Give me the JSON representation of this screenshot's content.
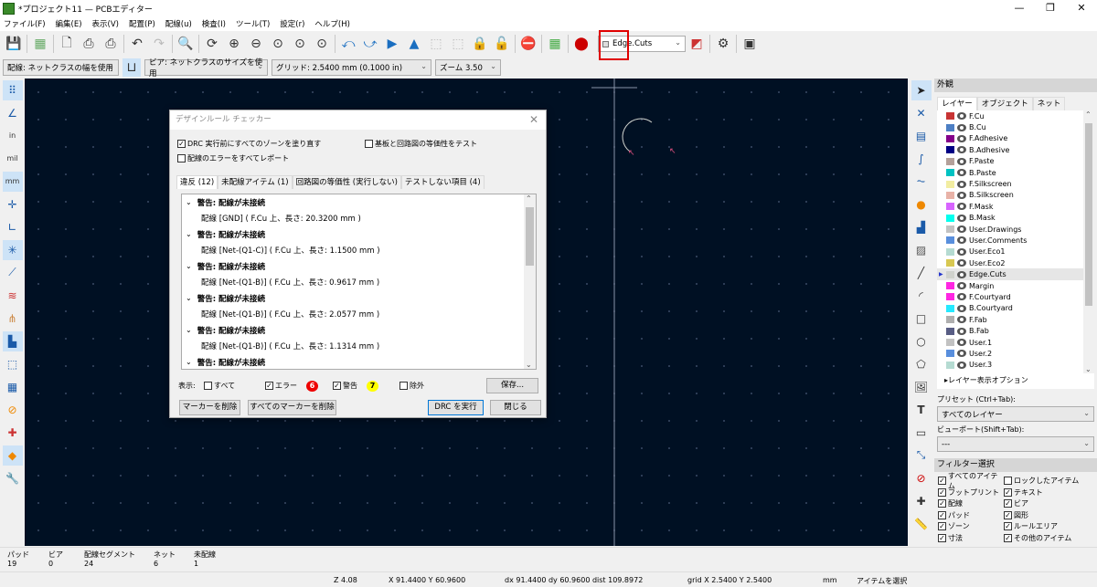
{
  "window": {
    "title": "*プロジェクト11 — PCBエディター"
  },
  "menu": [
    "ファイル(F)",
    "編集(E)",
    "表示(V)",
    "配置(P)",
    "配線(u)",
    "検査(I)",
    "ツール(T)",
    "設定(r)",
    "ヘルプ(H)"
  ],
  "toolbar": {
    "layer_select": "Edge.Cuts"
  },
  "toolbar2": {
    "track": "配線: ネットクラスの幅を使用",
    "via": "ビア: ネットクラスのサイズを使用",
    "grid": "グリッド: 2.5400 mm (0.1000 in)",
    "zoom": "ズーム 3.50"
  },
  "drc": {
    "title": "デザインルール チェッカー",
    "opt_refill": "DRC 実行前にすべてのゾーンを塗り直す",
    "opt_report_all": "配線のエラーをすべてレポート",
    "opt_parity": "基板と回路図の等価性をテスト",
    "tabs": [
      "違反 (12)",
      "未配線アイテム (1)",
      "回路図の等価性 (実行しない)",
      "テストしない項目 (4)"
    ],
    "items": [
      {
        "h": "警告: 配線が未接続",
        "d": "配線 [GND] ( F.Cu 上、長さ: 20.3200 mm )"
      },
      {
        "h": "警告: 配線が未接続",
        "d": "配線 [Net-(Q1-C)] ( F.Cu 上、長さ: 1.1500 mm )"
      },
      {
        "h": "警告: 配線が未接続",
        "d": "配線 [Net-(Q1-B)] ( F.Cu 上、長さ: 0.9617 mm )"
      },
      {
        "h": "警告: 配線が未接続",
        "d": "配線 [Net-(Q1-B)] ( F.Cu 上、長さ: 2.0577 mm )"
      },
      {
        "h": "警告: 配線が未接続",
        "d": "配線 [Net-(Q1-B)] ( F.Cu 上、長さ: 1.1314 mm )"
      },
      {
        "h": "警告: 配線が未接続"
      }
    ],
    "show_label": "表示:",
    "show_all": "すべて",
    "show_errors": "エラー",
    "error_count": "6",
    "show_warnings": "警告",
    "warning_count": "7",
    "show_excluded": "除外",
    "save": "保存...",
    "delete_markers": "マーカーを削除",
    "delete_all_markers": "すべてのマーカーを削除",
    "run": "DRC を実行",
    "close": "閉じる"
  },
  "panel": {
    "title": "外観",
    "tabs": [
      "レイヤー",
      "オブジェクト",
      "ネット"
    ],
    "layers": [
      {
        "n": "F.Cu",
        "c": "#c83434"
      },
      {
        "n": "B.Cu",
        "c": "#4d7fc4"
      },
      {
        "n": "F.Adhesive",
        "c": "#84008a"
      },
      {
        "n": "B.Adhesive",
        "c": "#000084"
      },
      {
        "n": "F.Paste",
        "c": "#b4a09a"
      },
      {
        "n": "B.Paste",
        "c": "#00c2c2"
      },
      {
        "n": "F.Silkscreen",
        "c": "#f2eda1"
      },
      {
        "n": "B.Silkscreen",
        "c": "#e8b2a7"
      },
      {
        "n": "F.Mask",
        "c": "#d864ff"
      },
      {
        "n": "B.Mask",
        "c": "#02ffee"
      },
      {
        "n": "User.Drawings",
        "c": "#c2c2c2"
      },
      {
        "n": "User.Comments",
        "c": "#598fdd"
      },
      {
        "n": "User.Eco1",
        "c": "#b5dbd2"
      },
      {
        "n": "User.Eco2",
        "c": "#d8c852"
      },
      {
        "n": "Edge.Cuts",
        "c": "#d0d2cd"
      },
      {
        "n": "Margin",
        "c": "#ff26e2"
      },
      {
        "n": "F.Courtyard",
        "c": "#ff26e2"
      },
      {
        "n": "B.Courtyard",
        "c": "#26e9ff"
      },
      {
        "n": "F.Fab",
        "c": "#afafaf"
      },
      {
        "n": "B.Fab",
        "c": "#585d84"
      },
      {
        "n": "User.1",
        "c": "#c2c2c2"
      },
      {
        "n": "User.2",
        "c": "#598fdd"
      },
      {
        "n": "User.3",
        "c": "#b5dbd2"
      }
    ],
    "layer_options": "レイヤー表示オプション",
    "preset_label": "プリセット (Ctrl+Tab):",
    "preset": "すべてのレイヤー",
    "viewport_label": "ビューポート(Shift+Tab):",
    "viewport": "---",
    "filter_title": "フィルター選択",
    "filters": [
      {
        "n": "すべてのアイテム",
        "on": true
      },
      {
        "n": "ロックしたアイテム",
        "on": false
      },
      {
        "n": "フットプリント",
        "on": true
      },
      {
        "n": "テキスト",
        "on": true
      },
      {
        "n": "配線",
        "on": true
      },
      {
        "n": "ビア",
        "on": true
      },
      {
        "n": "パッド",
        "on": true
      },
      {
        "n": "図形",
        "on": true
      },
      {
        "n": "ゾーン",
        "on": true
      },
      {
        "n": "ルールエリア",
        "on": true
      },
      {
        "n": "寸法",
        "on": true
      },
      {
        "n": "その他のアイテム",
        "on": true
      }
    ]
  },
  "stats": {
    "labels": [
      "パッド",
      "ビア",
      "配線セグメント",
      "ネット",
      "未配線"
    ],
    "values": [
      "19",
      "0",
      "24",
      "6",
      "1"
    ]
  },
  "status": {
    "zoom": "Z 4.08",
    "xy": "X 91.4400  Y 60.9600",
    "delta": "dx 91.4400  dy 60.9600  dist 109.8972",
    "grid": "grid X 2.5400  Y 2.5400",
    "units": "mm",
    "mode": "アイテムを選択"
  }
}
